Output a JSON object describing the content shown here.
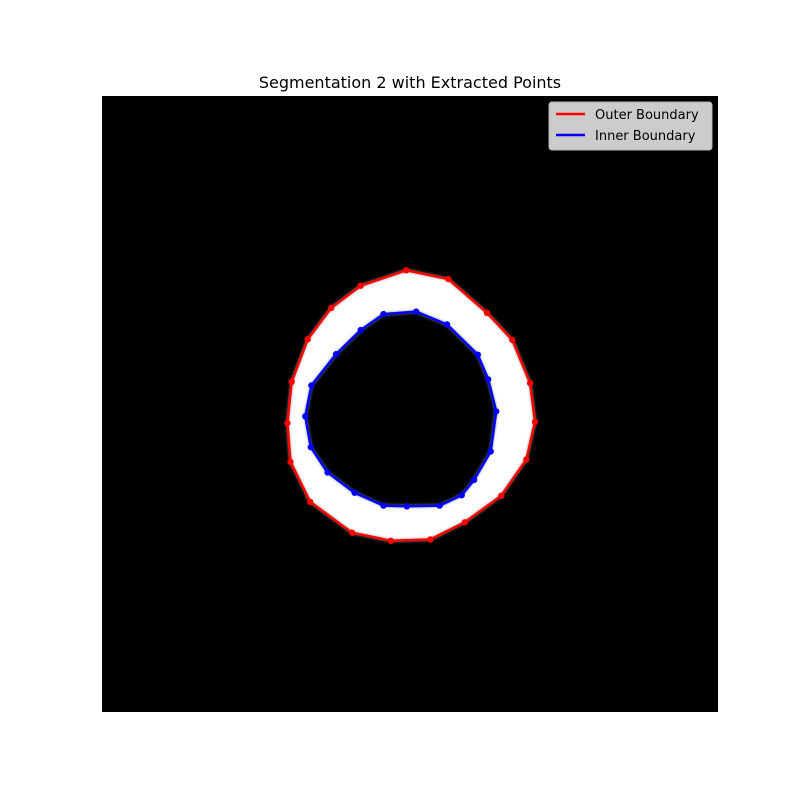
{
  "chart_data": {
    "type": "scatter",
    "title": "Segmentation 2 with Extracted Points",
    "xlabel": "",
    "ylabel": "",
    "xlim": [
      0,
      100
    ],
    "ylim": [
      100,
      0
    ],
    "axes_visible": false,
    "background_image": "binary segmentation mask: white ring on black background",
    "legend": {
      "placement": "top-right"
    },
    "series": [
      {
        "name": "Outer Boundary",
        "color": "#ff0000",
        "closed": true,
        "points": [
          [
            49.4,
            28.3
          ],
          [
            56.2,
            29.7
          ],
          [
            62.5,
            35.2
          ],
          [
            66.6,
            39.6
          ],
          [
            69.5,
            46.6
          ],
          [
            70.3,
            52.9
          ],
          [
            68.9,
            59.0
          ],
          [
            64.8,
            64.9
          ],
          [
            58.9,
            69.2
          ],
          [
            53.3,
            72.0
          ],
          [
            46.9,
            72.2
          ],
          [
            40.6,
            70.9
          ],
          [
            33.8,
            65.9
          ],
          [
            30.6,
            59.4
          ],
          [
            30.1,
            53.1
          ],
          [
            30.8,
            46.4
          ],
          [
            33.4,
            39.5
          ],
          [
            37.2,
            34.4
          ],
          [
            42.0,
            30.8
          ]
        ]
      },
      {
        "name": "Inner Boundary",
        "color": "#0000ff",
        "closed": true,
        "points": [
          [
            51.0,
            35.0
          ],
          [
            56.0,
            37.1
          ],
          [
            61.0,
            42.0
          ],
          [
            62.7,
            46.0
          ],
          [
            64.0,
            51.2
          ],
          [
            63.1,
            57.7
          ],
          [
            60.4,
            62.3
          ],
          [
            58.4,
            64.8
          ],
          [
            54.8,
            66.5
          ],
          [
            49.5,
            66.6
          ],
          [
            45.7,
            66.5
          ],
          [
            41.0,
            64.4
          ],
          [
            36.6,
            61.1
          ],
          [
            33.9,
            57.0
          ],
          [
            33.0,
            52.0
          ],
          [
            34.0,
            47.0
          ],
          [
            38.0,
            41.9
          ],
          [
            42.0,
            38.0
          ],
          [
            45.7,
            35.4
          ]
        ]
      }
    ]
  }
}
